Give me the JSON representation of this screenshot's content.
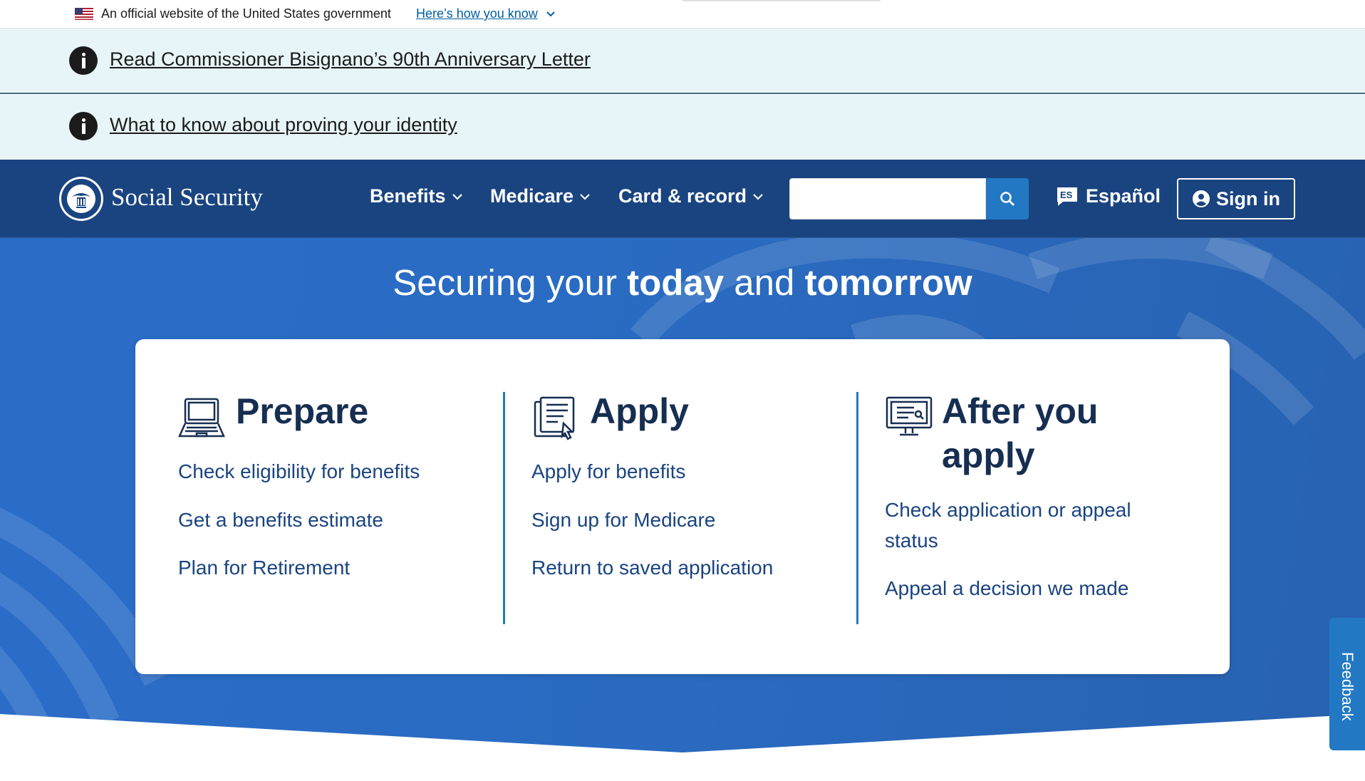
{
  "gov_banner": {
    "text": "An official website of the United States government",
    "how_link": "Here’s how you know"
  },
  "alerts": [
    {
      "text": "Read Commissioner Bisignano’s 90th Anniversary Letter"
    },
    {
      "text": "What to know about proving your identity"
    }
  ],
  "header": {
    "brand": "Social Security",
    "nav": [
      {
        "label": "Benefits"
      },
      {
        "label": "Medicare"
      },
      {
        "label": "Card & record"
      }
    ],
    "search": {
      "placeholder": "",
      "value": ""
    },
    "espanol": "Español",
    "sign_in": "Sign in"
  },
  "hero": {
    "title_part1": "Securing your ",
    "title_bold1": "today",
    "title_part2": " and ",
    "title_bold2": "tomorrow"
  },
  "columns": [
    {
      "title": "Prepare",
      "links": [
        "Check eligibility for benefits",
        "Get a benefits estimate",
        "Plan for Retirement"
      ]
    },
    {
      "title": "Apply",
      "links": [
        "Apply for benefits",
        "Sign up for Medicare",
        "Return to saved application"
      ]
    },
    {
      "title_line1": "After you",
      "title_line2": "apply",
      "links_line": [
        "Check application or appeal",
        "status"
      ],
      "links": [
        "Appeal a decision we made"
      ]
    }
  ],
  "feedback": "Feedback",
  "colors": {
    "header_bg": "#1a4480",
    "alert_bg": "#e8f5f8",
    "hero_bg": "#2a6cc8",
    "link": "#1a4480",
    "accent": "#2378c3"
  }
}
